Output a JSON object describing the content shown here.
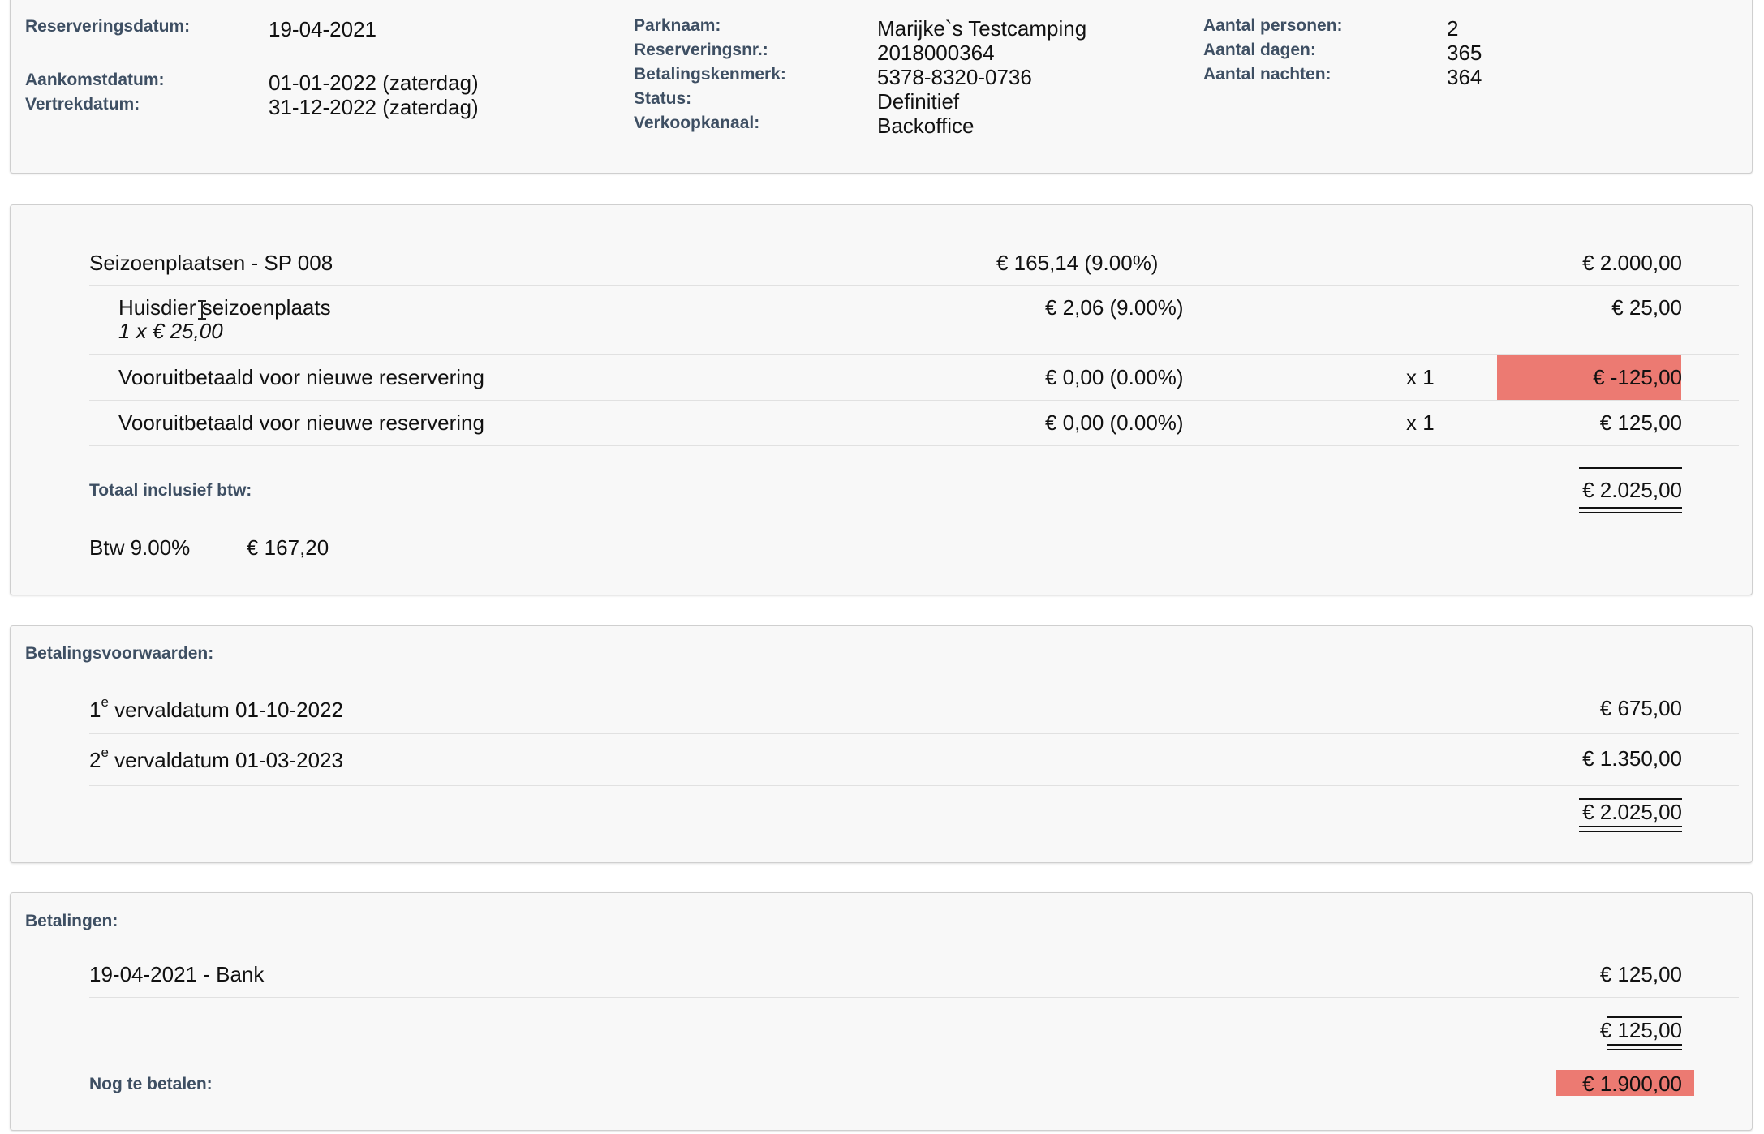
{
  "header": {
    "reserveringsdatum_label": "Reserveringsdatum:",
    "reserveringsdatum": "19-04-2021",
    "aankomst_label": "Aankomstdatum:",
    "aankomst": "01-01-2022 (zaterdag)",
    "vertrek_label": "Vertrekdatum:",
    "vertrek": "31-12-2022 (zaterdag)",
    "parknaam_label": "Parknaam:",
    "parknaam": "Marijke`s Testcamping",
    "reserveringsnr_label": "Reserveringsnr.:",
    "reserveringsnr": "2018000364",
    "betalingskenmerk_label": "Betalingskenmerk:",
    "betalingskenmerk": "5378-8320-0736",
    "status_label": "Status:",
    "status": "Definitief",
    "verkoopkanaal_label": "Verkoopkanaal:",
    "verkoopkanaal": "Backoffice",
    "personen_label": "Aantal personen:",
    "personen": "2",
    "dagen_label": "Aantal dagen:",
    "dagen": "365",
    "nachten_label": "Aantal nachten:",
    "nachten": "364"
  },
  "lines": {
    "main_name": "Seizoenplaatsen - SP 008",
    "main_tax": "€ 165,14 (9.00%)",
    "main_amount": "€ 2.000,00",
    "items": [
      {
        "name": "Huisdier seizoenplaats",
        "sub": "1 x € 25,00",
        "tax": "€ 2,06 (9.00%)",
        "qty": "",
        "amount": "€ 25,00"
      },
      {
        "name": "Vooruitbetaald voor nieuwe reservering",
        "sub": "",
        "tax": "€ 0,00 (0.00%)",
        "qty": "x 1",
        "amount": "€ -125,00"
      },
      {
        "name": "Vooruitbetaald voor nieuwe reservering",
        "sub": "",
        "tax": "€ 0,00 (0.00%)",
        "qty": "x 1",
        "amount": "€ 125,00"
      }
    ],
    "total_label": "Totaal inclusief btw:",
    "total": "€ 2.025,00",
    "btw_label": "Btw 9.00%",
    "btw_amount": "€ 167,20"
  },
  "conditions": {
    "title": "Betalingsvoorwaarden:",
    "items": [
      {
        "num": "1",
        "sup": "e",
        "text": " vervaldatum 01-10-2022",
        "amount": "€ 675,00"
      },
      {
        "num": "2",
        "sup": "e",
        "text": " vervaldatum 01-03-2023",
        "amount": "€ 1.350,00"
      }
    ],
    "total": "€ 2.025,00"
  },
  "payments": {
    "title": "Betalingen:",
    "items": [
      {
        "text": "19-04-2021 - Bank",
        "amount": "€ 125,00"
      }
    ],
    "total": "€ 125,00",
    "remaining_label": "Nog te betalen:",
    "remaining": "€ 1.900,00"
  },
  "colors": {
    "highlight": "#ec7a72",
    "label": "#3e4f63"
  }
}
